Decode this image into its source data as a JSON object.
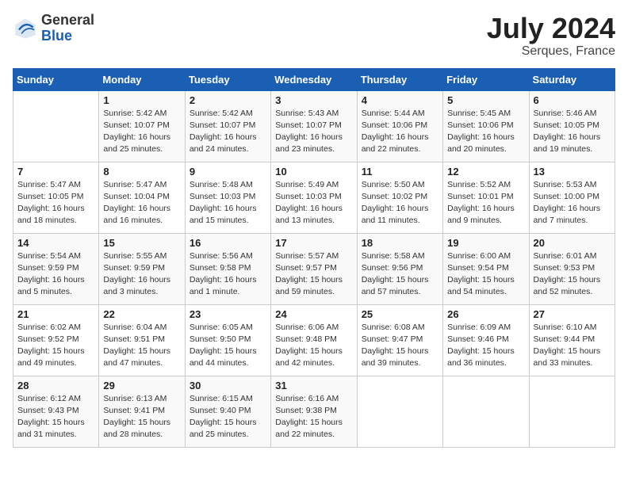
{
  "header": {
    "logo_general": "General",
    "logo_blue": "Blue",
    "month_year": "July 2024",
    "location": "Serques, France"
  },
  "days_of_week": [
    "Sunday",
    "Monday",
    "Tuesday",
    "Wednesday",
    "Thursday",
    "Friday",
    "Saturday"
  ],
  "weeks": [
    [
      {
        "day": "",
        "info": ""
      },
      {
        "day": "1",
        "info": "Sunrise: 5:42 AM\nSunset: 10:07 PM\nDaylight: 16 hours\nand 25 minutes."
      },
      {
        "day": "2",
        "info": "Sunrise: 5:42 AM\nSunset: 10:07 PM\nDaylight: 16 hours\nand 24 minutes."
      },
      {
        "day": "3",
        "info": "Sunrise: 5:43 AM\nSunset: 10:07 PM\nDaylight: 16 hours\nand 23 minutes."
      },
      {
        "day": "4",
        "info": "Sunrise: 5:44 AM\nSunset: 10:06 PM\nDaylight: 16 hours\nand 22 minutes."
      },
      {
        "day": "5",
        "info": "Sunrise: 5:45 AM\nSunset: 10:06 PM\nDaylight: 16 hours\nand 20 minutes."
      },
      {
        "day": "6",
        "info": "Sunrise: 5:46 AM\nSunset: 10:05 PM\nDaylight: 16 hours\nand 19 minutes."
      }
    ],
    [
      {
        "day": "7",
        "info": "Sunrise: 5:47 AM\nSunset: 10:05 PM\nDaylight: 16 hours\nand 18 minutes."
      },
      {
        "day": "8",
        "info": "Sunrise: 5:47 AM\nSunset: 10:04 PM\nDaylight: 16 hours\nand 16 minutes."
      },
      {
        "day": "9",
        "info": "Sunrise: 5:48 AM\nSunset: 10:03 PM\nDaylight: 16 hours\nand 15 minutes."
      },
      {
        "day": "10",
        "info": "Sunrise: 5:49 AM\nSunset: 10:03 PM\nDaylight: 16 hours\nand 13 minutes."
      },
      {
        "day": "11",
        "info": "Sunrise: 5:50 AM\nSunset: 10:02 PM\nDaylight: 16 hours\nand 11 minutes."
      },
      {
        "day": "12",
        "info": "Sunrise: 5:52 AM\nSunset: 10:01 PM\nDaylight: 16 hours\nand 9 minutes."
      },
      {
        "day": "13",
        "info": "Sunrise: 5:53 AM\nSunset: 10:00 PM\nDaylight: 16 hours\nand 7 minutes."
      }
    ],
    [
      {
        "day": "14",
        "info": "Sunrise: 5:54 AM\nSunset: 9:59 PM\nDaylight: 16 hours\nand 5 minutes."
      },
      {
        "day": "15",
        "info": "Sunrise: 5:55 AM\nSunset: 9:59 PM\nDaylight: 16 hours\nand 3 minutes."
      },
      {
        "day": "16",
        "info": "Sunrise: 5:56 AM\nSunset: 9:58 PM\nDaylight: 16 hours\nand 1 minute."
      },
      {
        "day": "17",
        "info": "Sunrise: 5:57 AM\nSunset: 9:57 PM\nDaylight: 15 hours\nand 59 minutes."
      },
      {
        "day": "18",
        "info": "Sunrise: 5:58 AM\nSunset: 9:56 PM\nDaylight: 15 hours\nand 57 minutes."
      },
      {
        "day": "19",
        "info": "Sunrise: 6:00 AM\nSunset: 9:54 PM\nDaylight: 15 hours\nand 54 minutes."
      },
      {
        "day": "20",
        "info": "Sunrise: 6:01 AM\nSunset: 9:53 PM\nDaylight: 15 hours\nand 52 minutes."
      }
    ],
    [
      {
        "day": "21",
        "info": "Sunrise: 6:02 AM\nSunset: 9:52 PM\nDaylight: 15 hours\nand 49 minutes."
      },
      {
        "day": "22",
        "info": "Sunrise: 6:04 AM\nSunset: 9:51 PM\nDaylight: 15 hours\nand 47 minutes."
      },
      {
        "day": "23",
        "info": "Sunrise: 6:05 AM\nSunset: 9:50 PM\nDaylight: 15 hours\nand 44 minutes."
      },
      {
        "day": "24",
        "info": "Sunrise: 6:06 AM\nSunset: 9:48 PM\nDaylight: 15 hours\nand 42 minutes."
      },
      {
        "day": "25",
        "info": "Sunrise: 6:08 AM\nSunset: 9:47 PM\nDaylight: 15 hours\nand 39 minutes."
      },
      {
        "day": "26",
        "info": "Sunrise: 6:09 AM\nSunset: 9:46 PM\nDaylight: 15 hours\nand 36 minutes."
      },
      {
        "day": "27",
        "info": "Sunrise: 6:10 AM\nSunset: 9:44 PM\nDaylight: 15 hours\nand 33 minutes."
      }
    ],
    [
      {
        "day": "28",
        "info": "Sunrise: 6:12 AM\nSunset: 9:43 PM\nDaylight: 15 hours\nand 31 minutes."
      },
      {
        "day": "29",
        "info": "Sunrise: 6:13 AM\nSunset: 9:41 PM\nDaylight: 15 hours\nand 28 minutes."
      },
      {
        "day": "30",
        "info": "Sunrise: 6:15 AM\nSunset: 9:40 PM\nDaylight: 15 hours\nand 25 minutes."
      },
      {
        "day": "31",
        "info": "Sunrise: 6:16 AM\nSunset: 9:38 PM\nDaylight: 15 hours\nand 22 minutes."
      },
      {
        "day": "",
        "info": ""
      },
      {
        "day": "",
        "info": ""
      },
      {
        "day": "",
        "info": ""
      }
    ]
  ]
}
